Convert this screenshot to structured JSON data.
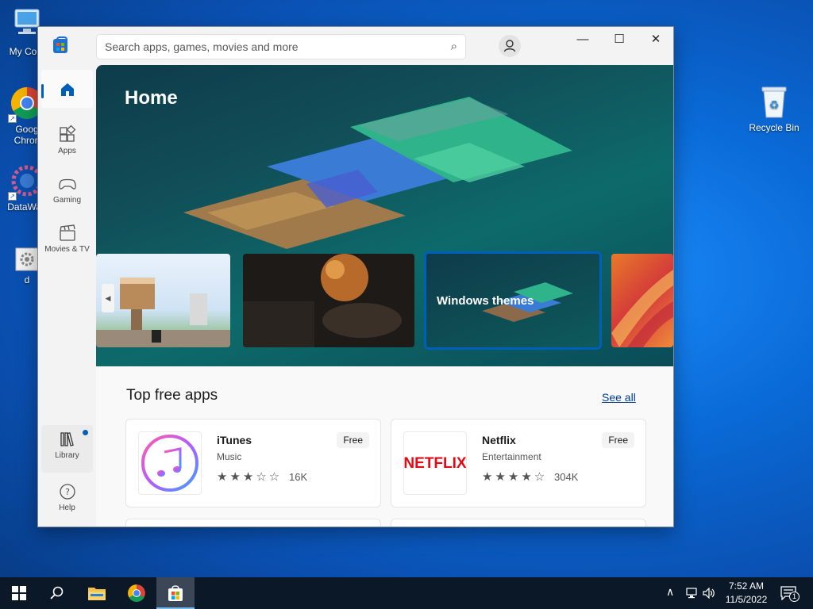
{
  "desktop": {
    "icons": [
      {
        "label": "My Com"
      },
      {
        "label": "Goog"
      },
      {
        "label": "Chron"
      },
      {
        "label": "DataWag"
      },
      {
        "label": "d"
      },
      {
        "label": "Recycle Bin"
      }
    ]
  },
  "window": {
    "search": {
      "placeholder": "Search apps, games, movies and more"
    },
    "controls": {
      "minimize": "—",
      "maximize": "☐",
      "close": "✕"
    }
  },
  "sidebar": {
    "items": [
      {
        "label": ""
      },
      {
        "label": "Apps"
      },
      {
        "label": "Gaming"
      },
      {
        "label": "Movies & TV"
      },
      {
        "label": "Library"
      },
      {
        "label": "Help"
      }
    ],
    "library_badge_color": "#005fb8"
  },
  "hero": {
    "title": "Home",
    "carousel": [
      {
        "label": ""
      },
      {
        "label": ""
      },
      {
        "label": "Windows themes"
      },
      {
        "label": ""
      }
    ]
  },
  "section": {
    "title": "Top free apps",
    "see_all": "See all",
    "apps": [
      {
        "name": "iTunes",
        "category": "Music",
        "rating": 3,
        "stars": "★★★☆☆",
        "count": "16K",
        "price": "Free",
        "icon": "itunes-icon"
      },
      {
        "name": "Netflix",
        "category": "Entertainment",
        "rating": 4,
        "stars": "★★★★☆",
        "count": "304K",
        "price": "Free",
        "icon": "netflix-logo",
        "logo_text": "NETFLIX"
      }
    ]
  },
  "taskbar": {
    "clock": {
      "time": "7:52 AM",
      "date": "11/5/2022"
    },
    "notification_count": "1"
  },
  "colors": {
    "accent": "#005fb8",
    "netflix": "#e50914",
    "desktop": "#0a6bd8"
  }
}
